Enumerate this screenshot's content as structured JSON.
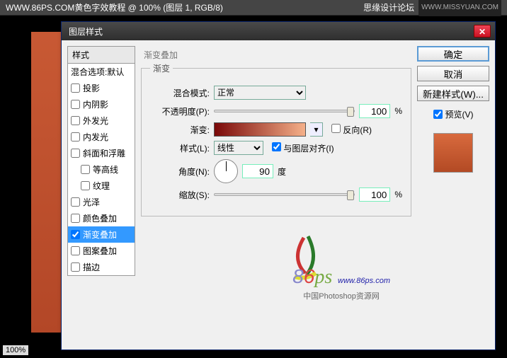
{
  "app": {
    "doc_title": "WWW.86PS.COM黄色字效教程 @ 100% (图层 1, RGB/8)",
    "forum": "思缘设计论坛",
    "site_tag": "WWW.MISSYUAN.COM",
    "zoom": "100%"
  },
  "dialog": {
    "title": "图层样式",
    "styles_header": "样式",
    "blend_defaults": "混合选项:默认",
    "styles": [
      {
        "label": "投影",
        "checked": false
      },
      {
        "label": "内阴影",
        "checked": false
      },
      {
        "label": "外发光",
        "checked": false
      },
      {
        "label": "内发光",
        "checked": false
      },
      {
        "label": "斜面和浮雕",
        "checked": false
      },
      {
        "label": "等高线",
        "checked": false,
        "indent": true
      },
      {
        "label": "纹理",
        "checked": false,
        "indent": true
      },
      {
        "label": "光泽",
        "checked": false
      },
      {
        "label": "颜色叠加",
        "checked": false
      },
      {
        "label": "渐变叠加",
        "checked": true,
        "selected": true
      },
      {
        "label": "图案叠加",
        "checked": false
      },
      {
        "label": "描边",
        "checked": false
      }
    ],
    "panel_title": "渐变叠加",
    "group_title": "渐变",
    "fields": {
      "blend_mode_label": "混合模式:",
      "blend_mode_value": "正常",
      "opacity_label": "不透明度(P):",
      "opacity_value": "100",
      "percent": "%",
      "gradient_label": "渐变:",
      "reverse_label": "反向(R)",
      "reverse_checked": false,
      "style_label": "样式(L):",
      "style_value": "线性",
      "align_label": "与图层对齐(I)",
      "align_checked": true,
      "angle_label": "角度(N):",
      "angle_value": "90",
      "degree": "度",
      "scale_label": "缩放(S):",
      "scale_value": "100"
    },
    "buttons": {
      "ok": "确定",
      "cancel": "取消",
      "new_style": "新建样式(W)...",
      "preview": "预览(V)"
    }
  },
  "watermark": {
    "brand_8": "8",
    "brand_6": "6",
    "brand_ps": "ps",
    "url": "www.86ps.com",
    "sub": "中国Photoshop资源网"
  }
}
